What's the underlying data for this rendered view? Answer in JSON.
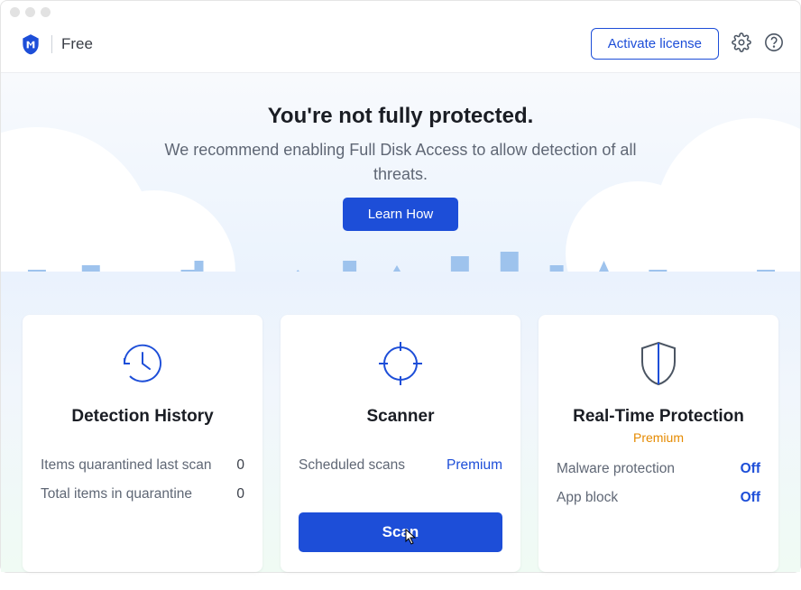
{
  "header": {
    "plan": "Free",
    "activate_label": "Activate license"
  },
  "hero": {
    "title": "You're not fully protected.",
    "subtitle": "We recommend enabling Full Disk Access to allow detection of all threats.",
    "learn_label": "Learn How"
  },
  "cards": {
    "detection": {
      "title": "Detection History",
      "row1_label": "Items quarantined last scan",
      "row1_value": "0",
      "row2_label": "Total items in quarantine",
      "row2_value": "0"
    },
    "scanner": {
      "title": "Scanner",
      "row1_label": "Scheduled scans",
      "row1_value": "Premium",
      "scan_label": "Scan"
    },
    "rtp": {
      "title": "Real-Time Protection",
      "badge": "Premium",
      "row1_label": "Malware protection",
      "row1_value": "Off",
      "row2_label": "App block",
      "row2_value": "Off"
    }
  }
}
